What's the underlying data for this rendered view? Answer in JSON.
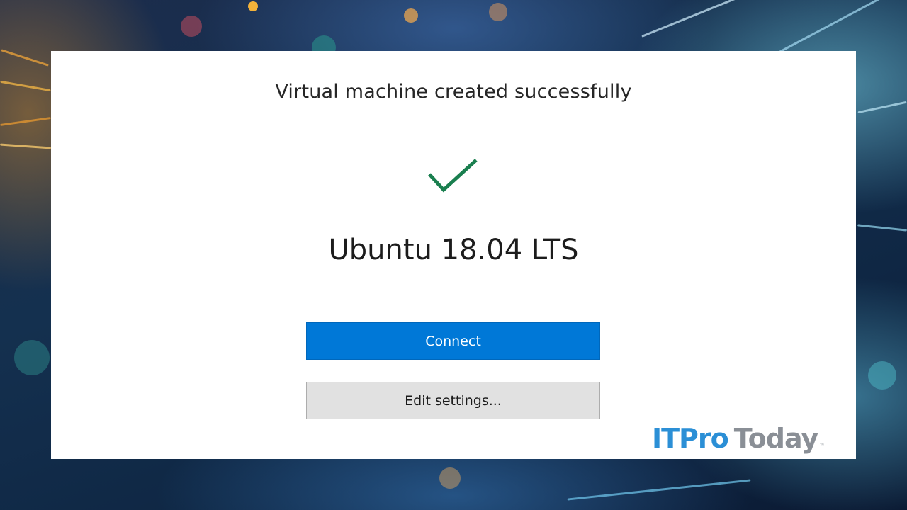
{
  "dialog": {
    "title": "Virtual machine created successfully",
    "vm_name": "Ubuntu 18.04 LTS",
    "status_icon": "checkmark-icon",
    "status_color": "#1a7f4f"
  },
  "buttons": {
    "connect_label": "Connect",
    "connect_color": "#0078d7",
    "edit_label": "Edit settings..."
  },
  "watermark": {
    "part1": "ITPro",
    "part2": "Today",
    "trademark": "™"
  }
}
